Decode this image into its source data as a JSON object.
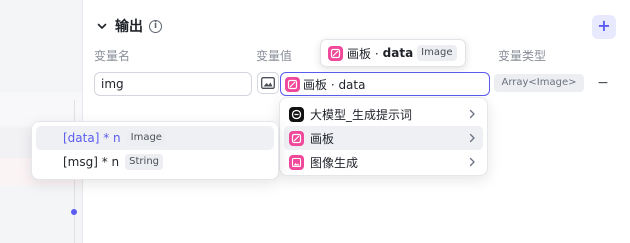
{
  "section": {
    "title": "输出",
    "info_icon": "i",
    "add_label": "+"
  },
  "columns": {
    "name": "变量名",
    "value": "变量值",
    "type": "变量类型"
  },
  "row": {
    "name_value": "img",
    "value_text": "画板 · data",
    "type_badge": "Array<Image>",
    "remove_label": "−"
  },
  "tooltip": {
    "prefix": "画板 · ",
    "bold": "data",
    "type": "Image"
  },
  "menu": {
    "items": [
      {
        "label": "大模型_生成提示词",
        "icon": "model-icon"
      },
      {
        "label": "画板",
        "icon": "canvas-board-icon"
      },
      {
        "label": "图像生成",
        "icon": "image-gen-icon"
      }
    ]
  },
  "submenu": {
    "items": [
      {
        "label": "[data] * n",
        "type": "Image"
      },
      {
        "label": "[msg] * n",
        "type": "String"
      }
    ]
  },
  "colors": {
    "accent": "#5a5cf0",
    "pink": "#f0489a"
  }
}
